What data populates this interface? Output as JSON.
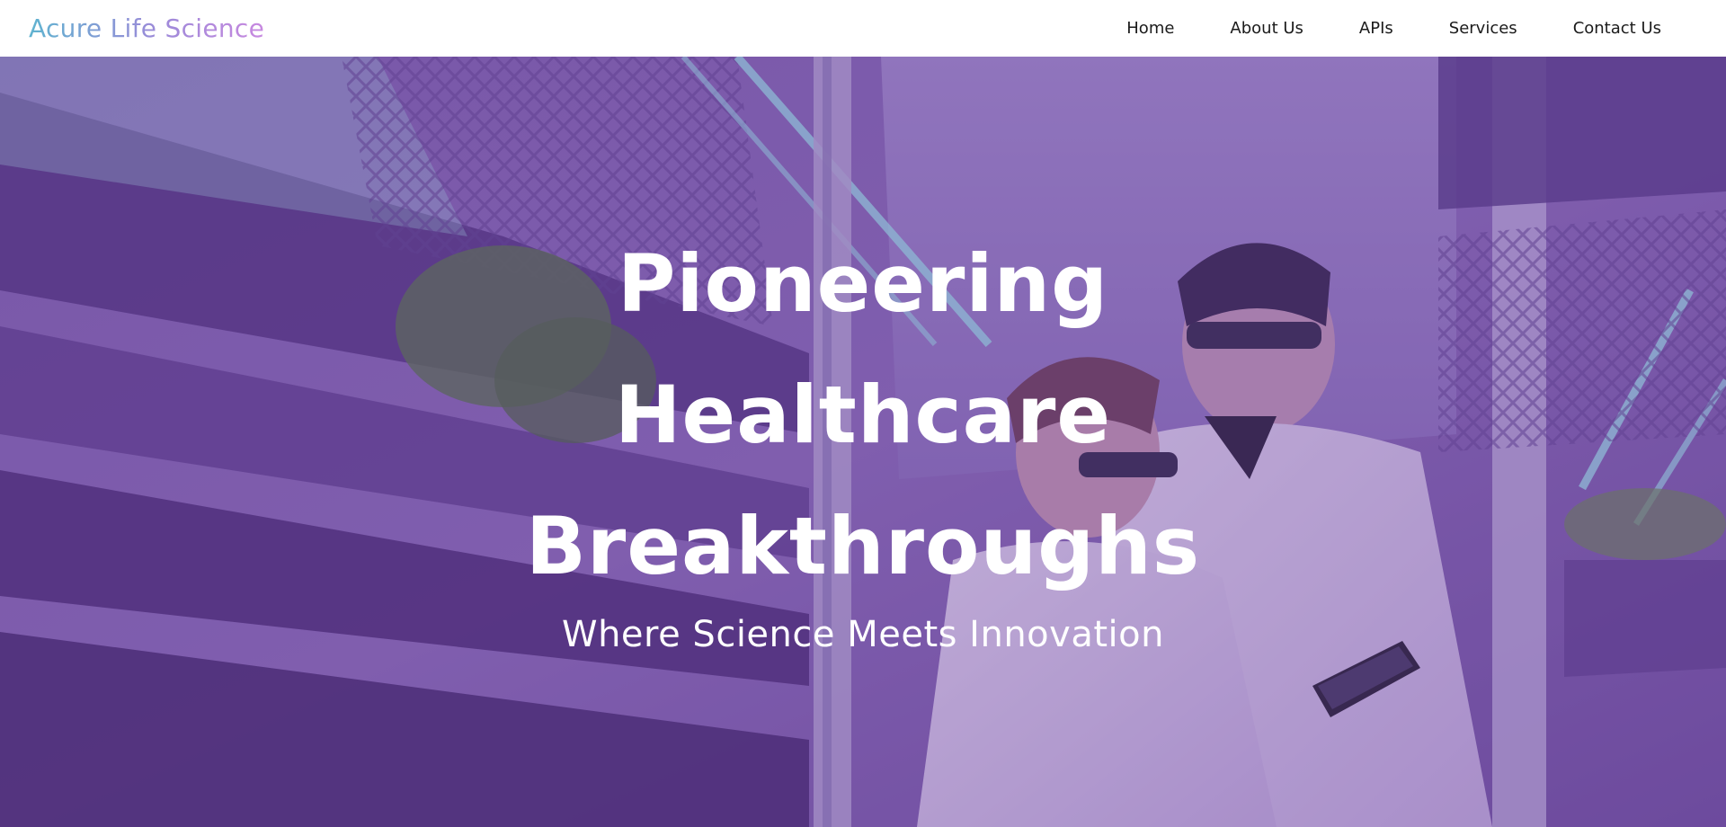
{
  "brand": {
    "name": "Acure Life Science"
  },
  "nav": {
    "items": [
      {
        "label": "Home"
      },
      {
        "label": "About Us"
      },
      {
        "label": "APIs"
      },
      {
        "label": "Services"
      },
      {
        "label": "Contact Us"
      }
    ]
  },
  "hero": {
    "title_lines": [
      "Pioneering",
      "Healthcare",
      "Breakthroughs"
    ],
    "subtitle": "Where Science Meets Innovation",
    "background_image": "laboratory-researchers-photo"
  },
  "colors": {
    "brand_gradient_start": "#5fb3d0",
    "brand_gradient_end": "#c889e0",
    "hero_overlay": "#6c46a0",
    "nav_text": "#1b1b1b",
    "hero_text": "#ffffff"
  }
}
